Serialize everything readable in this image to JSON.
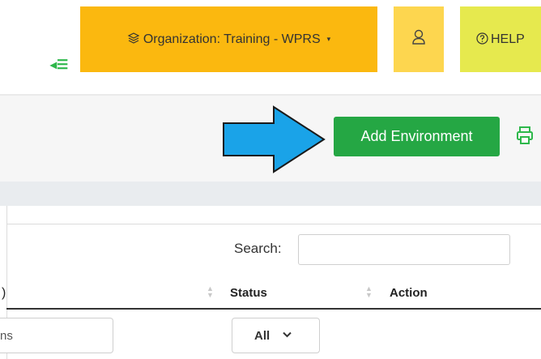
{
  "topbar": {
    "sidebar_toggle_glyph": "◂☰",
    "organization_label": "Organization: Training - WPRS",
    "organization_caret": "▾",
    "help_label": "HELP"
  },
  "actions": {
    "add_environment_label": "Add Environment"
  },
  "table": {
    "search_label": "Search:",
    "search_value": "",
    "partial_header_glyph": ")",
    "columns": [
      "Status",
      "Action"
    ],
    "filter_partial_value": "ns",
    "status_filter_value": "All"
  },
  "colors": {
    "organization_bg": "#fbb80f",
    "user_bg": "#fdd64f",
    "help_bg": "#e6e94e",
    "add_button_bg": "#25a744",
    "arrow_fill": "#1aa3e8"
  },
  "icons": [
    "menu-collapse-icon",
    "layers-icon",
    "user-icon",
    "help-circle-icon",
    "printer-icon",
    "sort-icon",
    "chevron-down-icon"
  ]
}
